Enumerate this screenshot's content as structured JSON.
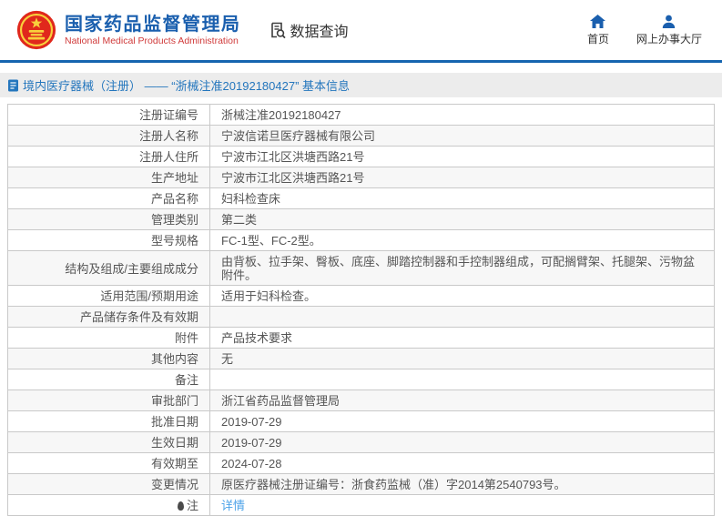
{
  "header": {
    "org_name_cn": "国家药品监督管理局",
    "org_name_en": "National Medical Products Administration",
    "section_title": "数据查询",
    "nav": [
      {
        "label": "首页",
        "icon": "home-icon"
      },
      {
        "label": "网上办事大厅",
        "icon": "user-icon"
      }
    ]
  },
  "breadcrumb": {
    "text": "境内医疗器械（注册） —— “浙械注准20192180427” 基本信息"
  },
  "table": {
    "rows": [
      {
        "label": "注册证编号",
        "value": "浙械注准20192180427"
      },
      {
        "label": "注册人名称",
        "value": "宁波信诺旦医疗器械有限公司"
      },
      {
        "label": "注册人住所",
        "value": "宁波市江北区洪塘西路21号"
      },
      {
        "label": "生产地址",
        "value": "宁波市江北区洪塘西路21号"
      },
      {
        "label": "产品名称",
        "value": "妇科检查床"
      },
      {
        "label": "管理类别",
        "value": "第二类"
      },
      {
        "label": "型号规格",
        "value": "FC-1型、FC-2型。"
      },
      {
        "label": "结构及组成/主要组成成分",
        "value": "由背板、拉手架、臀板、底座、脚踏控制器和手控制器组成，可配搁臂架、托腿架、污物盆附件。"
      },
      {
        "label": "适用范围/预期用途",
        "value": "适用于妇科检查。"
      },
      {
        "label": "产品储存条件及有效期",
        "value": ""
      },
      {
        "label": "附件",
        "value": "产品技术要求"
      },
      {
        "label": "其他内容",
        "value": "无"
      },
      {
        "label": "备注",
        "value": ""
      },
      {
        "label": "审批部门",
        "value": "浙江省药品监督管理局"
      },
      {
        "label": "批准日期",
        "value": "2019-07-29"
      },
      {
        "label": "生效日期",
        "value": "2019-07-29"
      },
      {
        "label": "有效期至",
        "value": "2024-07-28"
      },
      {
        "label": "变更情况",
        "value": "原医疗器械注册证编号：浙食药监械（准）字2014第2540793号。"
      },
      {
        "label": "注",
        "value": "详情",
        "link": true,
        "label_icon": "note-bulb-icon"
      }
    ]
  },
  "colors": {
    "header_blue": "#1a5fae",
    "header_border_blue": "#1564af",
    "org_en_red": "#d03a3a",
    "breadcrumb_bg": "#ececec",
    "breadcrumb_text": "#2476bd",
    "table_border": "#c9c9c9",
    "row_alt_bg": "#f7f7f7",
    "text_gray": "#555555",
    "link_blue": "#4da3e8",
    "emblem_red": "#e0281c",
    "emblem_gold": "#f8d03c"
  }
}
